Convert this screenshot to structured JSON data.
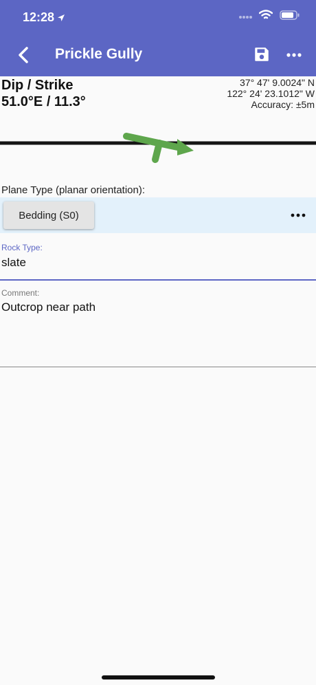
{
  "status_bar": {
    "time": "12:28",
    "location_icon": "location-arrow-icon",
    "signal_icon": "cellular-signal-icon",
    "wifi_icon": "wifi-icon",
    "battery_icon": "battery-icon"
  },
  "header": {
    "title": "Prickle Gully",
    "back_icon": "chevron-left-icon",
    "save_icon": "floppy-disk-icon",
    "more_icon": "more-horizontal-icon",
    "background_color": "#5c66c4"
  },
  "measurement": {
    "label": "Dip / Strike",
    "value": "51.0°E / 11.3°",
    "latitude": "37° 47' 9.0024\" N",
    "longitude": "122° 24' 23.1012\" W",
    "accuracy": "Accuracy: ±5m",
    "symbol_color": "#5ea64c"
  },
  "plane": {
    "label": "Plane Type (planar orientation):",
    "button_label": "Bedding (S0)",
    "more_icon": "more-horizontal-icon"
  },
  "rock_type": {
    "label": "Rock Type:",
    "value": "slate"
  },
  "comment": {
    "label": "Comment:",
    "value": "Outcrop near path"
  }
}
